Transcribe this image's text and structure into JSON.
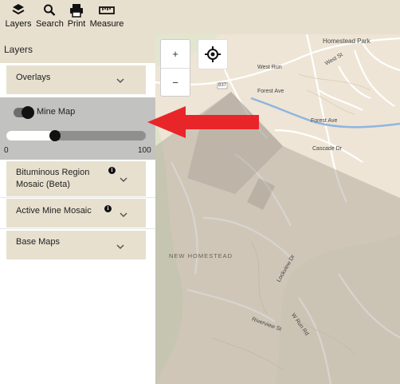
{
  "toolbar": {
    "layers_label": "Layers",
    "search_label": "Search",
    "print_label": "Print",
    "measure_label": "Measure",
    "icons": [
      "layers-icon",
      "search-icon",
      "print-icon",
      "measure-icon"
    ]
  },
  "panel": {
    "title": "Layers",
    "sections": {
      "overlays": "Overlays",
      "bituminous": "Bituminous Region Mosaic (Beta)",
      "active_mine": "Active Mine Mosaic",
      "base_maps": "Base Maps"
    },
    "mine_map": {
      "label": "Mine Map",
      "toggle_on": true,
      "opacity_value": 35,
      "range_min": "0",
      "range_max": "100"
    }
  },
  "map": {
    "zoom_in": "+",
    "zoom_out": "−",
    "labels": {
      "homestead_park": "Homestead Park",
      "new_homestead": "NEW HOMESTEAD",
      "west_run": "West Run",
      "forest_ave": "Forest Ave",
      "forest_ave_2": "Forest Ave",
      "w_run_rd": "W Run Rd",
      "cascade_dr": "Cascade Dr",
      "west_st": "West St",
      "lockview_dr": "Lockview Dr",
      "riverview_st": "Riverview St",
      "route": "837"
    }
  },
  "colors": {
    "toolbar_bg": "#e8e0cf",
    "accordion_bg": "#e8e0cf",
    "mine_panel_bg": "#c2c2c0",
    "arrow": "#e8262a",
    "water": "#8fb5e0"
  }
}
